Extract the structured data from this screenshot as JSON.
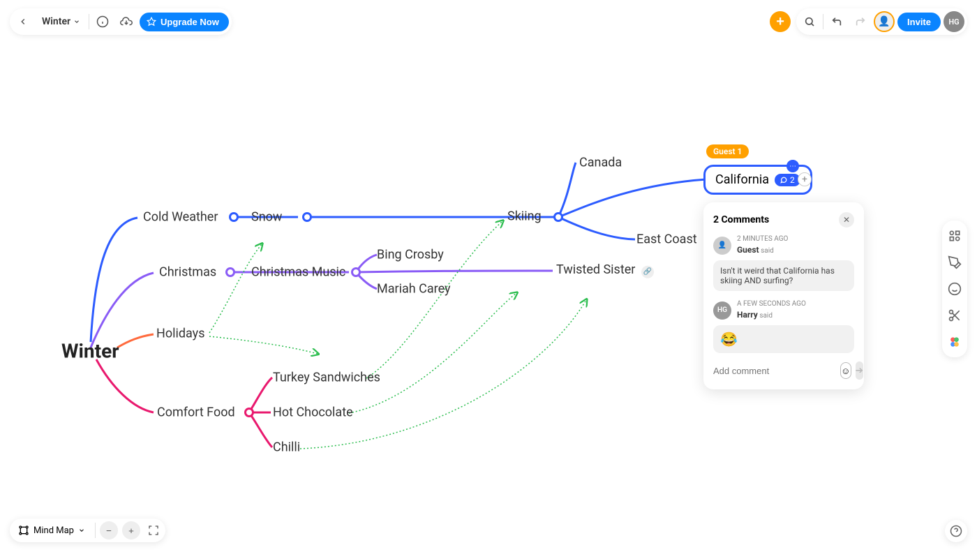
{
  "header": {
    "file_name": "Winter",
    "upgrade_label": "Upgrade Now",
    "invite_label": "Invite",
    "user_initials": "HG"
  },
  "mindmap": {
    "root": "Winter",
    "branches": {
      "cold_weather": "Cold Weather",
      "snow": "Snow",
      "skiing": "Skiing",
      "canada": "Canada",
      "california": "California",
      "east_coast": "East Coast",
      "christmas": "Christmas",
      "christmas_music": "Christmas Music",
      "bing_crosby": "Bing Crosby",
      "mariah_carey": "Mariah Carey",
      "twisted_sister": "Twisted Sister",
      "holidays": "Holidays",
      "comfort_food": "Comfort Food",
      "turkey_sandwiches": "Turkey Sandwiches",
      "hot_chocolate": "Hot Chocolate",
      "chilli": "Chilli"
    }
  },
  "selected_node": {
    "guest_label": "Guest 1",
    "comment_count": "2"
  },
  "comments": {
    "title": "2 Comments",
    "items": [
      {
        "time": "2 MINUTES AGO",
        "author": "Guest",
        "said": "said",
        "body": "Isn't it weird that California has skiing AND surfing?",
        "avatar": "👤"
      },
      {
        "time": "A FEW SECONDS AGO",
        "author": "Harry",
        "said": "said",
        "body": "😂",
        "avatar": "HG"
      }
    ],
    "placeholder": "Add comment"
  },
  "bottom": {
    "view_label": "Mind Map"
  },
  "colors": {
    "blue": "#2d5cff",
    "purple": "#8a5cf6",
    "orange": "#ff6a3d",
    "pink": "#e9196e",
    "green": "#2bbd4e",
    "accent": "#ffa000"
  }
}
